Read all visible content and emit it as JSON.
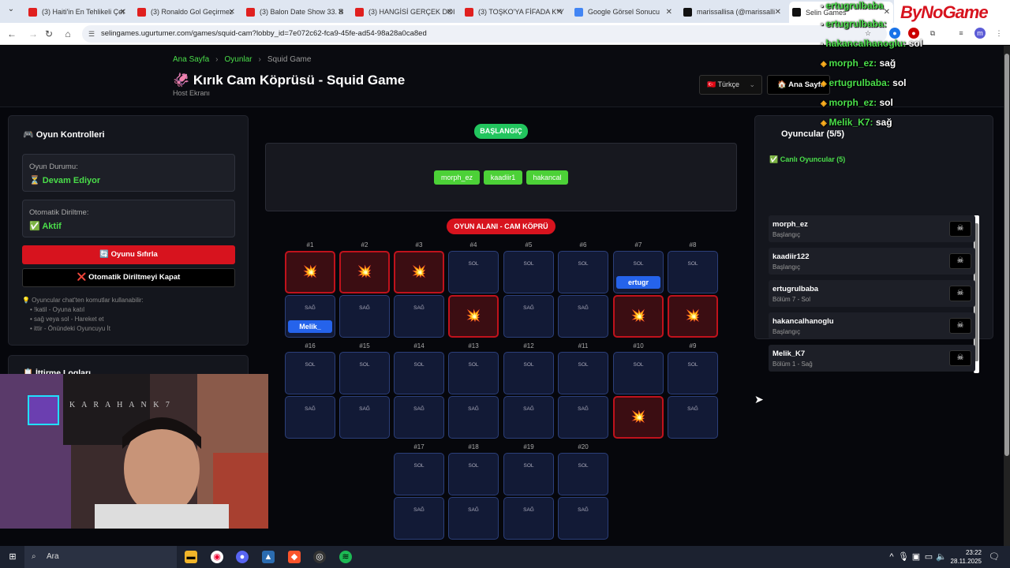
{
  "tabs": [
    {
      "title": "(3) Haiti'in En Tehlikeli Çet",
      "color": "#e0201f"
    },
    {
      "title": "(3) Ronaldo Gol Geçirmez",
      "color": "#e0201f"
    },
    {
      "title": "(3) Balon Date Show 33. B",
      "color": "#e0201f"
    },
    {
      "title": "(3) HANGİSİ GERÇEK DOI",
      "color": "#e0201f"
    },
    {
      "title": "(3) TOŞKO'YA FİFADA K*Y",
      "color": "#e0201f"
    },
    {
      "title": "Google Görsel Sonucu",
      "color": "#4285f4"
    },
    {
      "title": "marissallisa (@marissalli",
      "color": "#111111"
    },
    {
      "title": "Selin Games",
      "color": "#111111"
    }
  ],
  "address": {
    "url": "selingames.ugurtumer.com/games/squid-cam?lobby_id=7e072c62-fca9-45fe-ad54-98a28a0ca8ed"
  },
  "breadcrumb": {
    "home": "Ana Sayfa",
    "games": "Oyunlar",
    "current": "Squid Game"
  },
  "header": {
    "title": "🦑 Kırık Cam Köprüsü - Squid Game",
    "subtitle": "Host Ekranı",
    "language": "🇹🇷 Türkçe",
    "home_button": "🏠 Ana Sayfa"
  },
  "left": {
    "title": "🎮 Oyun Kontrolleri",
    "status_label": "Oyun Durumu:",
    "status_value": "⏳ Devam Ediyor",
    "revive_label": "Otomatik Diriltme:",
    "revive_value": "✅ Aktif",
    "reset_button": "🔄 Oyunu Sıfırla",
    "auto_button": "❌ Otomatik Diriltmeyi Kapat",
    "hint_title": "💡 Oyuncular chat'ten komutlar kullanabilir:",
    "hints": [
      "!katil - Oyuna katıl",
      "sağ veya sol - Hareket et",
      "ittir - Önündeki Oyuncuyu İt"
    ],
    "log_title": "📋 İttirme Logları"
  },
  "start": {
    "badge": "BAŞLANGIÇ",
    "players": [
      "morph_ez",
      "kaadiir1",
      "hakancal"
    ]
  },
  "game_area_badge": "OYUN ALANI - CAM KÖPRÜ",
  "bridge": {
    "row1": [
      {
        "num": "#1",
        "top": "broken",
        "bottom": "SAĞ",
        "bottom_player": "Melik_"
      },
      {
        "num": "#2",
        "top": "broken",
        "bottom": "SAĞ"
      },
      {
        "num": "#3",
        "top": "broken",
        "bottom": "SAĞ"
      },
      {
        "num": "#4",
        "top": "SOL",
        "bottom": "broken"
      },
      {
        "num": "#5",
        "top": "SOL",
        "bottom": "SAĞ"
      },
      {
        "num": "#6",
        "top": "SOL",
        "bottom": "SAĞ"
      },
      {
        "num": "#7",
        "top": "SOL",
        "top_player": "ertugr",
        "bottom": "broken"
      },
      {
        "num": "#8",
        "top": "SOL",
        "bottom": "broken"
      }
    ],
    "row2": [
      {
        "num": "#16",
        "top": "SOL",
        "bottom": "SAĞ"
      },
      {
        "num": "#15",
        "top": "SOL",
        "bottom": "SAĞ"
      },
      {
        "num": "#14",
        "top": "SOL",
        "bottom": "SAĞ"
      },
      {
        "num": "#13",
        "top": "SOL",
        "bottom": "SAĞ"
      },
      {
        "num": "#12",
        "top": "SOL",
        "bottom": "SAĞ"
      },
      {
        "num": "#11",
        "top": "SOL",
        "bottom": "SAĞ"
      },
      {
        "num": "#10",
        "top": "SOL",
        "bottom": "broken"
      },
      {
        "num": "#9",
        "top": "SOL",
        "bottom": "SAĞ"
      }
    ],
    "row3": [
      {
        "num": "#17",
        "top": "SOL",
        "bottom": "SAĞ"
      },
      {
        "num": "#18",
        "top": "SOL",
        "bottom": "SAĞ"
      },
      {
        "num": "#19",
        "top": "SOL",
        "bottom": "SAĞ"
      },
      {
        "num": "#20",
        "top": "SOL",
        "bottom": "SAĞ"
      }
    ],
    "broken_symbol": "💥"
  },
  "right": {
    "title": "Oyuncular (5/5)",
    "live_label": "✅ Canlı Oyuncular (5)",
    "players": [
      {
        "name": "morph_ez",
        "status": "Başlangıç"
      },
      {
        "name": "kaadiir122",
        "status": "Başlangıç"
      },
      {
        "name": "ertugrulbaba",
        "status": "Bölüm 7 - Sol"
      },
      {
        "name": "hakancalhanoglu",
        "status": "Başlangıç"
      },
      {
        "name": "Melik_K7",
        "status": "Bölüm 1 - Sağ"
      }
    ],
    "kill_icon": "☠"
  },
  "chat": [
    {
      "user": "ertugrulbaba",
      "msg": ""
    },
    {
      "user": "ertugrulbaba:",
      "msg": ""
    },
    {
      "user": "hakancalhanoglu:",
      "msg": "sol"
    },
    {
      "user": "morph_ez:",
      "msg": "sağ"
    },
    {
      "user": "ertugrulbaba:",
      "msg": "sol"
    },
    {
      "user": "morph_ez:",
      "msg": "sol"
    },
    {
      "user": "Melik_K7:",
      "msg": "sağ"
    }
  ],
  "logo": "ByNoGame",
  "webcam_text": "K A R A H A N K 7",
  "taskbar": {
    "search": "Ara",
    "time": "23:22",
    "date": "28.11.2025"
  }
}
